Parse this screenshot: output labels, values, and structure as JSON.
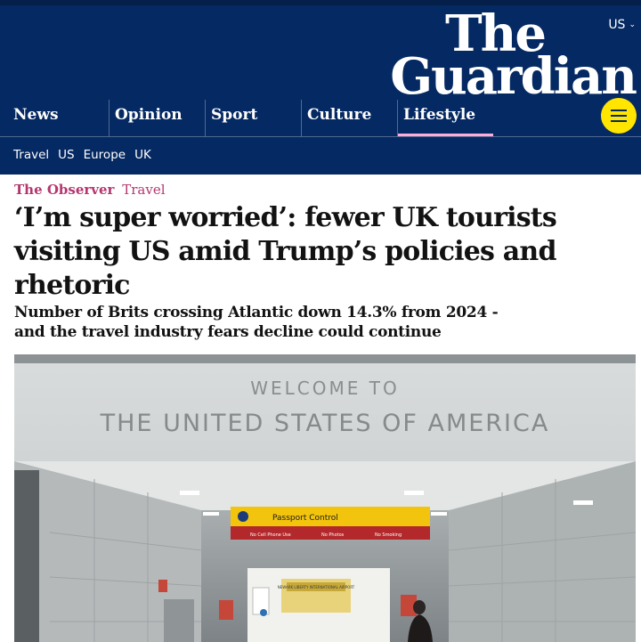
{
  "header": {
    "edition_label": "US",
    "logo_line1": "The",
    "logo_line2": "Guardian",
    "pillars": [
      {
        "label": "News",
        "active": false
      },
      {
        "label": "Opinion",
        "active": false
      },
      {
        "label": "Sport",
        "active": false
      },
      {
        "label": "Culture",
        "active": false
      },
      {
        "label": "Lifestyle",
        "active": true
      }
    ],
    "subnav": [
      "Travel",
      "US",
      "Europe",
      "UK"
    ]
  },
  "article": {
    "series": "The Observer",
    "section": "Travel",
    "headline": "‘I’m super worried’: fewer UK tourists visiting US amid Trump’s policies and rhetoric",
    "standfirst": "Number of Brits crossing Atlantic down 14.3% from 2024 - and the travel industry fears decline could continue"
  },
  "photo": {
    "sign_line1": "WELCOME TO",
    "sign_line2": "THE UNITED STATES OF AMERICA",
    "panel_title": "Passport Control",
    "panel_items": [
      "No Cell Phone Use",
      "No Photos",
      "No Smoking"
    ],
    "poster_text": "NEWARK LIBERTY INTERNATIONAL AIRPORT"
  },
  "colors": {
    "brand_blue": "#052962",
    "lifestyle_pink": "#ffabdb",
    "kicker_pink": "#b5366f",
    "menu_yellow": "#ffe500"
  }
}
